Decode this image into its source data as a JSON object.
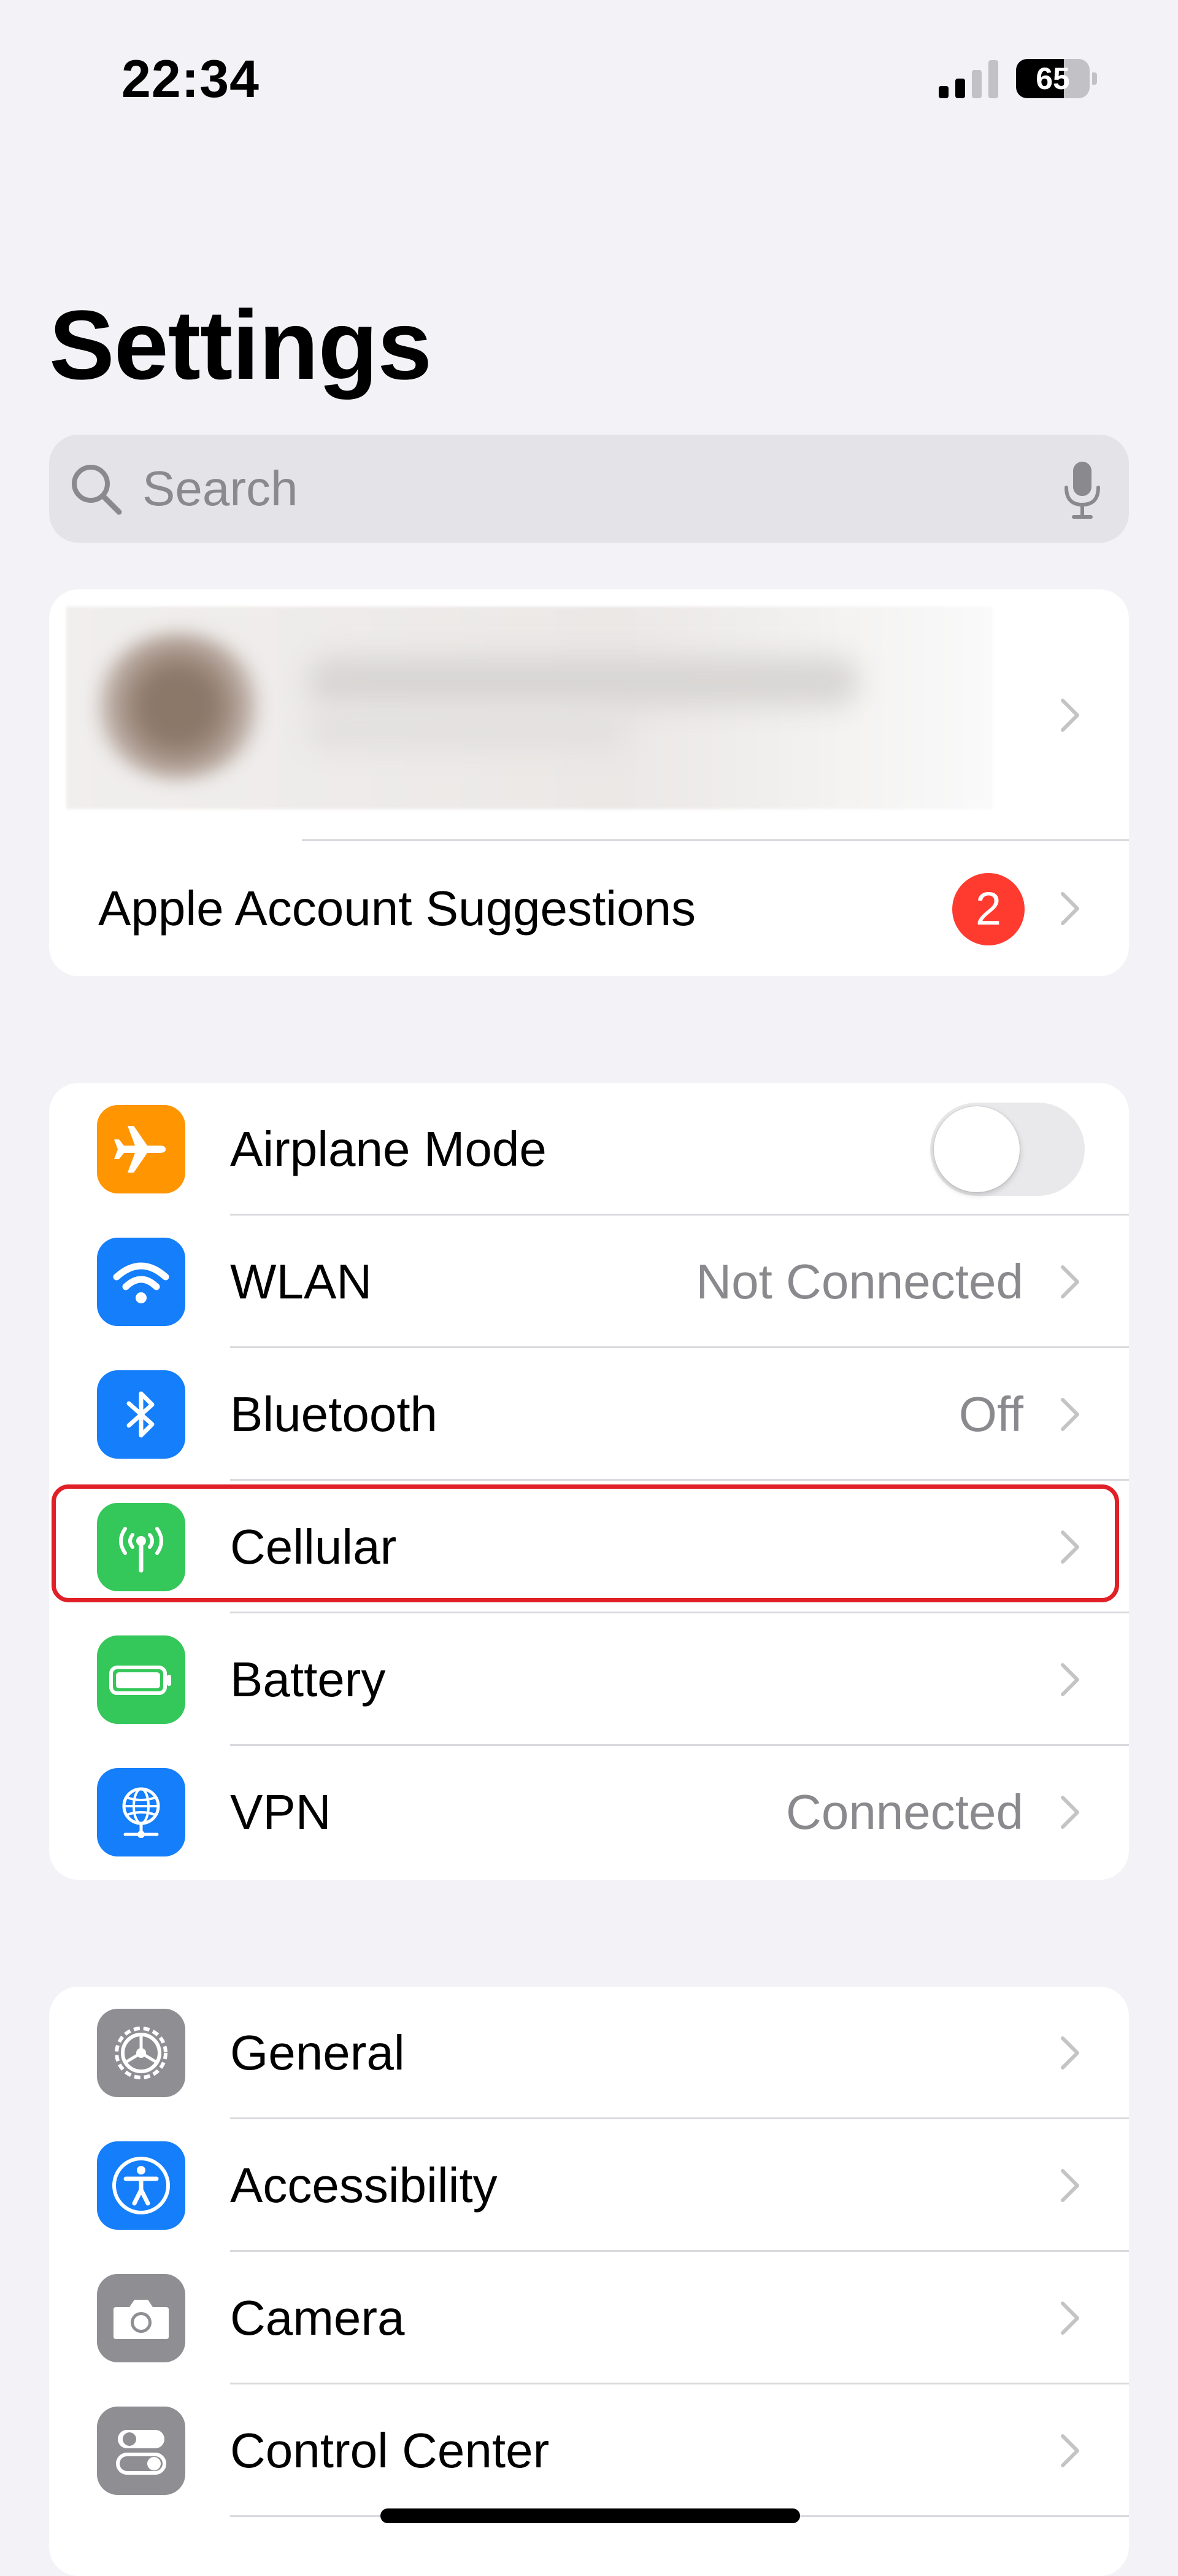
{
  "status_bar": {
    "time": "22:34",
    "battery_percent": "65",
    "battery_level": 0.65
  },
  "page_title": "Settings",
  "search": {
    "placeholder": "Search"
  },
  "account_card": {
    "suggestions_label": "Apple Account Suggestions",
    "suggestions_badge": "2"
  },
  "connectivity": {
    "airplane_mode": {
      "label": "Airplane Mode",
      "enabled": false
    },
    "wlan": {
      "label": "WLAN",
      "value": "Not Connected"
    },
    "bluetooth": {
      "label": "Bluetooth",
      "value": "Off"
    },
    "cellular": {
      "label": "Cellular"
    },
    "battery": {
      "label": "Battery"
    },
    "vpn": {
      "label": "VPN",
      "value": "Connected"
    }
  },
  "general_group": {
    "general": {
      "label": "General"
    },
    "accessibility": {
      "label": "Accessibility"
    },
    "camera": {
      "label": "Camera"
    },
    "control_center": {
      "label": "Control Center"
    }
  },
  "colors": {
    "background": "#f2f2f7",
    "airplane_orange": "#ff9500",
    "system_blue": "#147efb",
    "system_green": "#34c759",
    "system_gray": "#8e8e93",
    "badge_red": "#ff3b30",
    "highlight_red": "#e01f26"
  }
}
